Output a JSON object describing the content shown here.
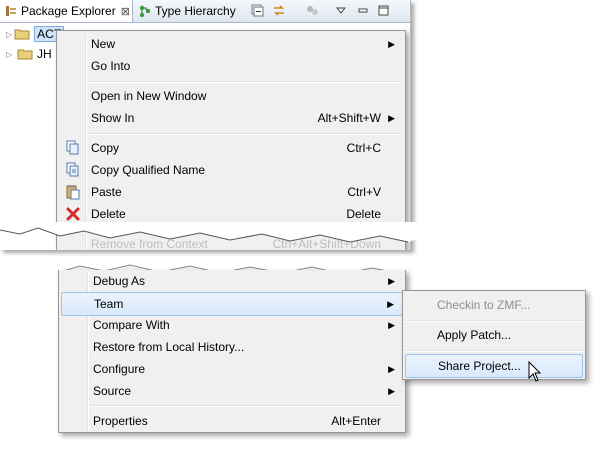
{
  "explorer": {
    "tabs": [
      {
        "label": "Package Explorer",
        "close": "⊠"
      },
      {
        "label": "Type Hierarchy"
      }
    ],
    "tree": [
      {
        "label": "ACT"
      },
      {
        "label": "JH"
      }
    ]
  },
  "context_menu_top": {
    "items": [
      {
        "label": "New"
      },
      {
        "label": "Go Into"
      },
      {
        "label": "Open in New Window"
      },
      {
        "label": "Show In",
        "accel": "Alt+Shift+W"
      },
      {
        "label": "Copy",
        "accel": "Ctrl+C"
      },
      {
        "label": "Copy Qualified Name"
      },
      {
        "label": "Paste",
        "accel": "Ctrl+V"
      },
      {
        "label": "Delete",
        "accel": "Delete"
      }
    ],
    "partial_item": {
      "label": "Remove from Context",
      "accel": "Ctrl+Alt+Shift+Down"
    }
  },
  "context_menu_bottom": {
    "items": [
      {
        "label": "Debug As"
      },
      {
        "label": "Team"
      },
      {
        "label": "Compare With"
      },
      {
        "label": "Restore from Local History..."
      },
      {
        "label": "Configure"
      },
      {
        "label": "Source"
      },
      {
        "label": "Properties",
        "accel": "Alt+Enter"
      }
    ]
  },
  "team_submenu": {
    "items": [
      {
        "label": "Checkin to ZMF..."
      },
      {
        "label": "Apply Patch..."
      },
      {
        "label": "Share Project..."
      }
    ]
  },
  "colors": {
    "highlight": "#d9e9fb",
    "highlight_border": "#9fc3ef",
    "menu_bg": "#f0f0f0",
    "delete_icon": "#d92b2b"
  }
}
